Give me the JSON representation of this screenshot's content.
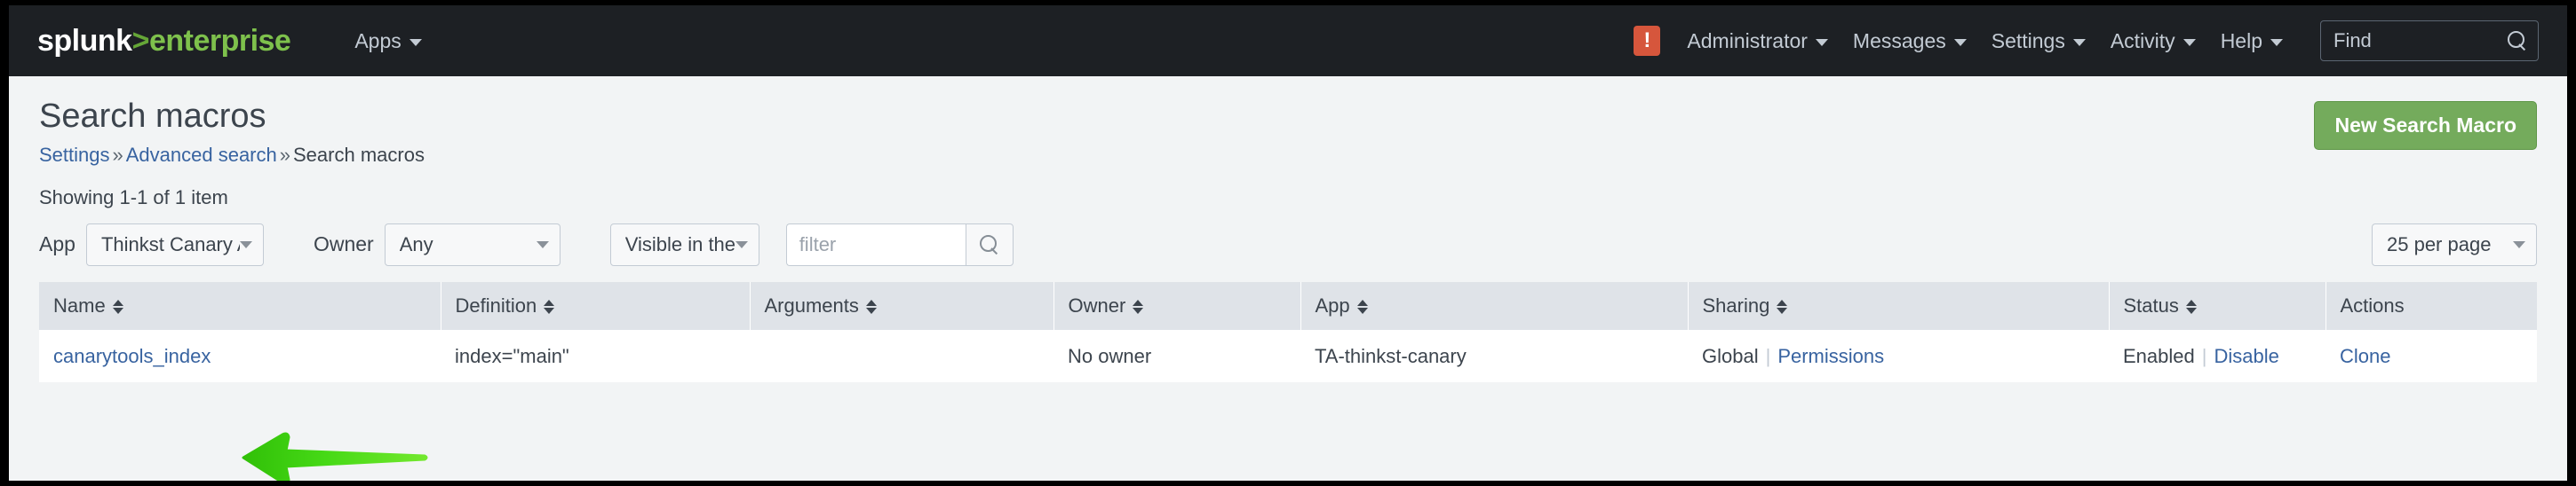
{
  "header": {
    "logo": {
      "part1": "splunk",
      "part2": ">",
      "part3": "enterprise"
    },
    "apps_label": "Apps",
    "alert_icon": "alert-exclamation-icon",
    "alert_badge": "!",
    "nav": [
      {
        "label": "Administrator",
        "name": "administrator"
      },
      {
        "label": "Messages",
        "name": "messages"
      },
      {
        "label": "Settings",
        "name": "settings"
      },
      {
        "label": "Activity",
        "name": "activity"
      },
      {
        "label": "Help",
        "name": "help"
      }
    ],
    "find": {
      "label": "Find",
      "icon": "search-icon"
    }
  },
  "page": {
    "title": "Search macros",
    "breadcrumb": {
      "item1": "Settings",
      "sep1": "»",
      "item2": "Advanced search",
      "sep2": "»",
      "item3": "Search macros"
    },
    "new_button": "New Search Macro",
    "showing": "Showing 1-1 of 1 item"
  },
  "filters": {
    "app_label": "App",
    "app_value": "Thinkst Canary Add-on f ",
    "owner_label": "Owner",
    "owner_value": "Any",
    "sharing_value": "Visible in the App",
    "filter_placeholder": "filter",
    "filter_value": "",
    "search_icon": "search-icon",
    "per_page_value": "25 per page"
  },
  "table": {
    "columns": [
      {
        "label": "Name",
        "sortable": true
      },
      {
        "label": "Definition",
        "sortable": true
      },
      {
        "label": "Arguments",
        "sortable": true
      },
      {
        "label": "Owner",
        "sortable": true
      },
      {
        "label": "App",
        "sortable": true
      },
      {
        "label": "Sharing",
        "sortable": true
      },
      {
        "label": "Status",
        "sortable": true
      },
      {
        "label": "Actions",
        "sortable": false
      }
    ],
    "rows": [
      {
        "name": "canarytools_index",
        "definition": "index=\"main\"",
        "arguments": "",
        "owner": "No owner",
        "app": "TA-thinkst-canary",
        "sharing_value": "Global",
        "sharing_link": "Permissions",
        "status_value": "Enabled",
        "status_link": "Disable",
        "action_link": "Clone"
      }
    ]
  },
  "annotation": {
    "arrow": "green-left-arrow-annotation",
    "points_at": "canarytools_index"
  },
  "colors": {
    "header_bg": "#1d2024",
    "brand_green": "#7ec14c",
    "button_green": "#74ab5c",
    "link_blue": "#3863a0",
    "alert_red": "#d6563c",
    "annotation_green": "#3fd11a",
    "table_header_bg": "#dfe3e8",
    "page_bg": "#f2f4f5"
  }
}
